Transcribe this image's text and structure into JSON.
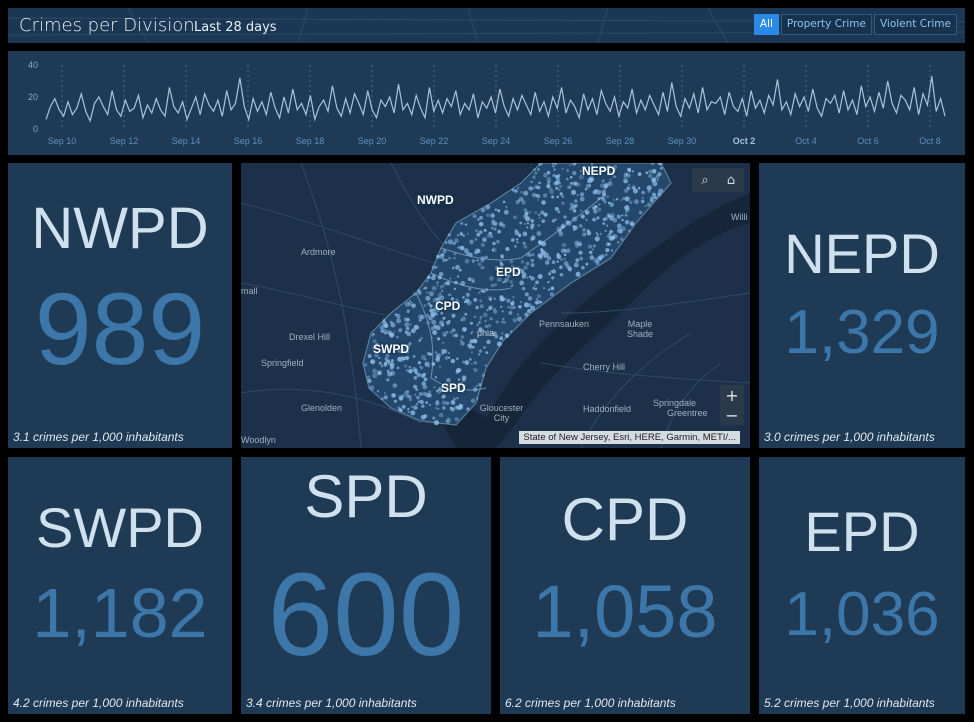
{
  "header": {
    "title": "Crimes per Division",
    "subtitle": "Last 28 days",
    "filters": [
      {
        "label": "All",
        "active": true
      },
      {
        "label": "Property Crime",
        "active": false
      },
      {
        "label": "Violent Crime",
        "active": false
      }
    ]
  },
  "chart_data": {
    "type": "line",
    "title": "",
    "xlabel": "",
    "ylabel": "",
    "ylim": [
      0,
      40
    ],
    "y_ticks": [
      "0",
      "20",
      "40"
    ],
    "x_ticks": [
      "Sep 10",
      "Sep 12",
      "Sep 14",
      "Sep 16",
      "Sep 18",
      "Sep 20",
      "Sep 22",
      "Sep 24",
      "Sep 26",
      "Sep 28",
      "Sep 30",
      "Oct 2",
      "Oct 4",
      "Oct 6",
      "Oct 8"
    ],
    "x_ticks_bold": [
      "Oct 2"
    ],
    "grid": "vertical dotted",
    "color": "#a9c3db",
    "series": [
      {
        "values": [
          6,
          14,
          19,
          12,
          8,
          17,
          9,
          13,
          22,
          11,
          5,
          16,
          20,
          14,
          9,
          24,
          12,
          8,
          18,
          11,
          13,
          21,
          7,
          15,
          10,
          19,
          12,
          8,
          26,
          14,
          10,
          17,
          6,
          13,
          20,
          9,
          22,
          15,
          11,
          18,
          8,
          24,
          12,
          16,
          32,
          14,
          6,
          19,
          11,
          17,
          9,
          23,
          13,
          7,
          20,
          10,
          25,
          12,
          16,
          9,
          21,
          6,
          14,
          18,
          11,
          27,
          13,
          8,
          19,
          10,
          22,
          16,
          9,
          24,
          12,
          7,
          18,
          14,
          20,
          10,
          28,
          12,
          16,
          9,
          21,
          13,
          7,
          26,
          11,
          18,
          10,
          19,
          14,
          24,
          9,
          16,
          12,
          22,
          7,
          17,
          13,
          20,
          10,
          25,
          14,
          8,
          19,
          12,
          21,
          15,
          9,
          23,
          11,
          17,
          8,
          20,
          13,
          26,
          10,
          18,
          14,
          7,
          22,
          12,
          19,
          9,
          24,
          16,
          11,
          20,
          8,
          17,
          13,
          25,
          10,
          18,
          12,
          21,
          15,
          9,
          23,
          11,
          29,
          14,
          8,
          19,
          13,
          22,
          10,
          26,
          12,
          17,
          16,
          20,
          9,
          23,
          14,
          11,
          19,
          8,
          24,
          13,
          18,
          10,
          21,
          15,
          31,
          12,
          17,
          9,
          22,
          14,
          20,
          11,
          25,
          13,
          8,
          19,
          16,
          21,
          10,
          24,
          12,
          18,
          9,
          27,
          14,
          20,
          11,
          23,
          13,
          30,
          16,
          10,
          21,
          18,
          12,
          26,
          9,
          22,
          15,
          33,
          11,
          19,
          8
        ]
      }
    ]
  },
  "map": {
    "division_labels": [
      "NEPD",
      "NWPD",
      "EPD",
      "CPD",
      "SWPD",
      "SPD"
    ],
    "places": [
      "Ardmore",
      "Drexel Hill",
      "Springfield",
      "Glenolden",
      "Woodlyn",
      "Pennsauken",
      "Maple Shade",
      "Cherry Hill",
      "Haddonfield",
      "Springdale",
      "Greentree",
      "Gloucester City",
      "Willi",
      "mall",
      "phia"
    ],
    "attribution": "State of New Jersey, Esri, HERE, Garmin, METI/...",
    "tools": {
      "search": "⌕",
      "home": "⌂",
      "zoom_in": "+",
      "zoom_out": "−"
    }
  },
  "cards": {
    "nwpd": {
      "division": "NWPD",
      "count": "989",
      "rate": "3.1 crimes per 1,000 inhabitants"
    },
    "nepd": {
      "division": "NEPD",
      "count": "1,329",
      "rate": "3.0 crimes per 1,000 inhabitants"
    },
    "swpd": {
      "division": "SWPD",
      "count": "1,182",
      "rate": "4.2 crimes per 1,000 inhabitants"
    },
    "spd": {
      "division": "SPD",
      "count": "600",
      "rate": "3.4 crimes per 1,000 inhabitants"
    },
    "cpd": {
      "division": "CPD",
      "count": "1,058",
      "rate": "6.2 crimes per 1,000 inhabitants"
    },
    "epd": {
      "division": "EPD",
      "count": "1,036",
      "rate": "5.2 crimes per 1,000 inhabitants"
    }
  },
  "colors": {
    "panel": "#1f3a55",
    "count_text": "#3d76a8",
    "division_text": "#cfe0ee",
    "accent": "#2b8ae6",
    "crime_dot": "#8fc0ec"
  }
}
